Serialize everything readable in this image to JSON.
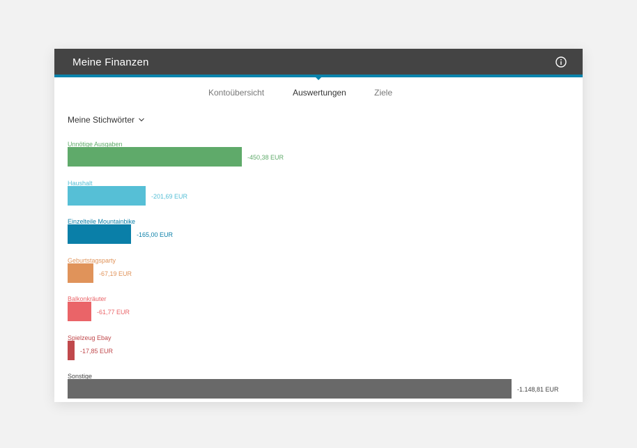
{
  "app": {
    "title": "Meine Finanzen"
  },
  "tabs": [
    {
      "label": "Kontoübersicht",
      "active": false
    },
    {
      "label": "Auswertungen",
      "active": true
    },
    {
      "label": "Ziele",
      "active": false
    }
  ],
  "filter": {
    "label": "Meine Stichwörter"
  },
  "icons": {
    "info": "info-icon",
    "dropdown": "chevron-down-icon"
  },
  "chart_data": {
    "type": "bar",
    "orientation": "horizontal",
    "unit": "EUR",
    "categories": [
      "Unnötige Ausgaben",
      "Haushalt",
      "Einzelteile Mountainbike",
      "Geburtstagsparty",
      "Balkonkräuter",
      "Spielzeug Ebay",
      "Sonstige"
    ],
    "values": [
      -450.38,
      -201.69,
      -165.0,
      -67.19,
      -61.77,
      -17.85,
      -1148.81
    ],
    "value_labels": [
      "-450,38 EUR",
      "-201,69 EUR",
      "-165,00 EUR",
      "-67,19 EUR",
      "-61,77 EUR",
      "-17,85 EUR",
      "-1.148,81 EUR"
    ],
    "colors": [
      "#5faa6a",
      "#56bfd6",
      "#0a7fa8",
      "#e0935a",
      "#ea6468",
      "#c0494c",
      "#696969"
    ]
  }
}
